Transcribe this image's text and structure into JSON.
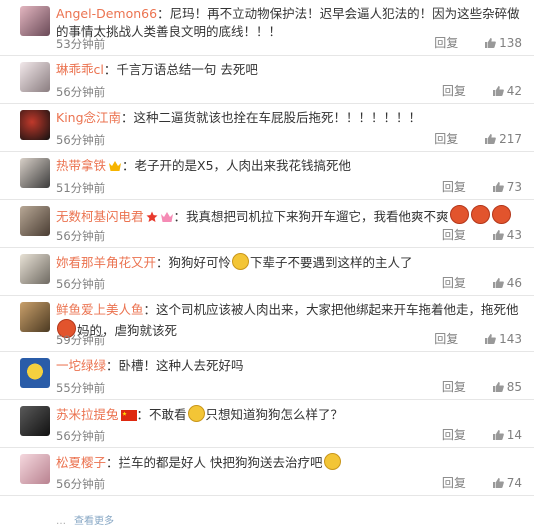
{
  "comments": [
    {
      "user": "Angel-Demon66",
      "sep": "：",
      "text": "尼玛！再不立动物保护法！迟早会逼人犯法的！因为这些杂碎做的事情太挑战人类善良文明的底线！！！",
      "time": "53分钟前",
      "reply": "回复",
      "likes": "138"
    },
    {
      "user": "琳乖乖cl",
      "sep": "：",
      "text": "千言万语总结一句 去死吧",
      "time": "56分钟前",
      "reply": "回复",
      "likes": "42"
    },
    {
      "user": "King念江南",
      "sep": "：",
      "text": "这种二逼货就该也拴在车屁股后拖死！！！！！！！",
      "time": "56分钟前",
      "reply": "回复",
      "likes": "217"
    },
    {
      "user": "热带拿铁",
      "sep": "：",
      "text": "老子开的是X5，人肉出来我花钱搞死他",
      "time": "51分钟前",
      "reply": "回复",
      "likes": "73"
    },
    {
      "user": "无数柯基闪电君",
      "sep": "：",
      "text": "我真想把司机拉下来狗开车遛它，我看他爽不爽",
      "time": "56分钟前",
      "reply": "回复",
      "likes": "43"
    },
    {
      "user": "妳看那羊角花又开",
      "sep": "：",
      "text_a": "狗狗好可怜",
      "text_b": "下辈子不要遇到这样的主人了",
      "time": "56分钟前",
      "reply": "回复",
      "likes": "46"
    },
    {
      "user": "鲜鱼爱上美人鱼",
      "sep": "：",
      "text_a": "这个司机应该被人肉出来，大家把他绑起来开车拖着他走，拖死他",
      "text_b": "妈的，虐狗就该死",
      "time": "59分钟前",
      "reply": "回复",
      "likes": "143"
    },
    {
      "user": "一坨绿绿",
      "sep": "：",
      "text": "卧槽！这种人去死好吗",
      "time": "55分钟前",
      "reply": "回复",
      "likes": "85"
    },
    {
      "user": "苏米拉提兔",
      "sep": "：",
      "text_a": "不敢看",
      "text_b": "只想知道狗狗怎么样了？",
      "time": "56分钟前",
      "reply": "回复",
      "likes": "14"
    },
    {
      "user": "松夏樱子",
      "sep": "：",
      "text": "拦车的都是好人 快把狗狗送去治疗吧",
      "time": "56分钟前",
      "reply": "回复",
      "likes": "74"
    }
  ],
  "footer": {
    "partial": "…",
    "more": "查看更多"
  },
  "colors": {
    "username": "#eb7350",
    "meta": "#808080",
    "angry_emoji": "#e2542d",
    "sad_emoji": "#f3c536"
  },
  "icons": {
    "like": "thumbs-up-icon",
    "vip": "crown-icon",
    "flag": "china-flag-icon",
    "star": "star-badge-icon"
  }
}
